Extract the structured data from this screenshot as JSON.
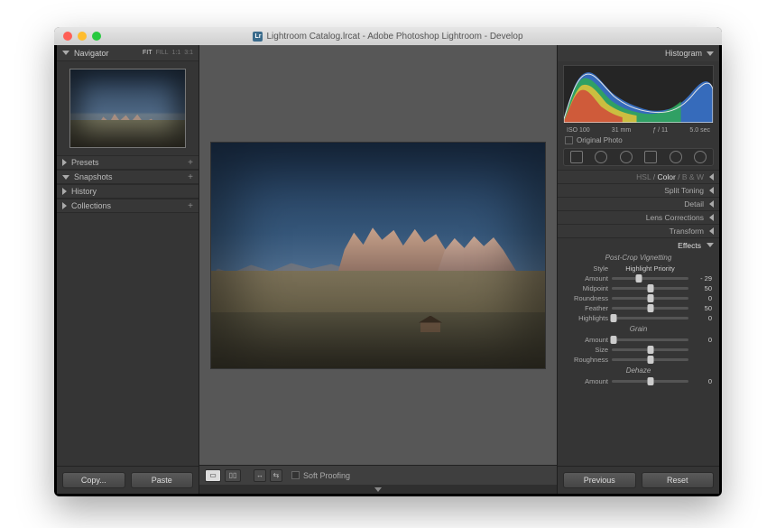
{
  "window": {
    "title": "Lightroom Catalog.lrcat - Adobe Photoshop Lightroom - Develop"
  },
  "leftPanel": {
    "navigator": {
      "title": "Navigator",
      "modes": [
        "FIT",
        "FILL",
        "1:1",
        "3:1"
      ],
      "active": "FIT"
    },
    "sections": [
      {
        "label": "Presets",
        "expanded": false
      },
      {
        "label": "Snapshots",
        "expanded": true
      },
      {
        "label": "History",
        "expanded": false
      },
      {
        "label": "Collections",
        "expanded": false
      }
    ],
    "copy": "Copy...",
    "paste": "Paste"
  },
  "toolbar": {
    "softProofing": "Soft Proofing"
  },
  "rightPanel": {
    "histogram": {
      "title": "Histogram"
    },
    "meta": {
      "iso": "ISO 100",
      "focal": "31 mm",
      "aperture": "ƒ / 11",
      "shutter": "5.0 sec"
    },
    "originalPhoto": "Original Photo",
    "panels": {
      "hsl": {
        "tabs": [
          "HSL",
          "Color",
          "B & W"
        ],
        "active": "Color"
      },
      "split": "Split Toning",
      "detail": "Detail",
      "lens": "Lens Corrections",
      "transform": "Transform",
      "effects": "Effects"
    },
    "effects": {
      "vignette": {
        "title": "Post-Crop Vignetting",
        "styleLabel": "Style",
        "styleValue": "Highlight Priority",
        "sliders": [
          {
            "name": "Amount",
            "value": "- 29",
            "pos": 35
          },
          {
            "name": "Midpoint",
            "value": "50",
            "pos": 50
          },
          {
            "name": "Roundness",
            "value": "0",
            "pos": 50
          },
          {
            "name": "Feather",
            "value": "50",
            "pos": 50
          },
          {
            "name": "Highlights",
            "value": "0",
            "pos": 2
          }
        ]
      },
      "grain": {
        "title": "Grain",
        "sliders": [
          {
            "name": "Amount",
            "value": "0",
            "pos": 2
          },
          {
            "name": "Size",
            "value": "",
            "pos": 50
          },
          {
            "name": "Roughness",
            "value": "",
            "pos": 50
          }
        ]
      },
      "dehaze": {
        "title": "Dehaze",
        "sliders": [
          {
            "name": "Amount",
            "value": "0",
            "pos": 50
          }
        ]
      }
    },
    "previous": "Previous",
    "reset": "Reset"
  }
}
